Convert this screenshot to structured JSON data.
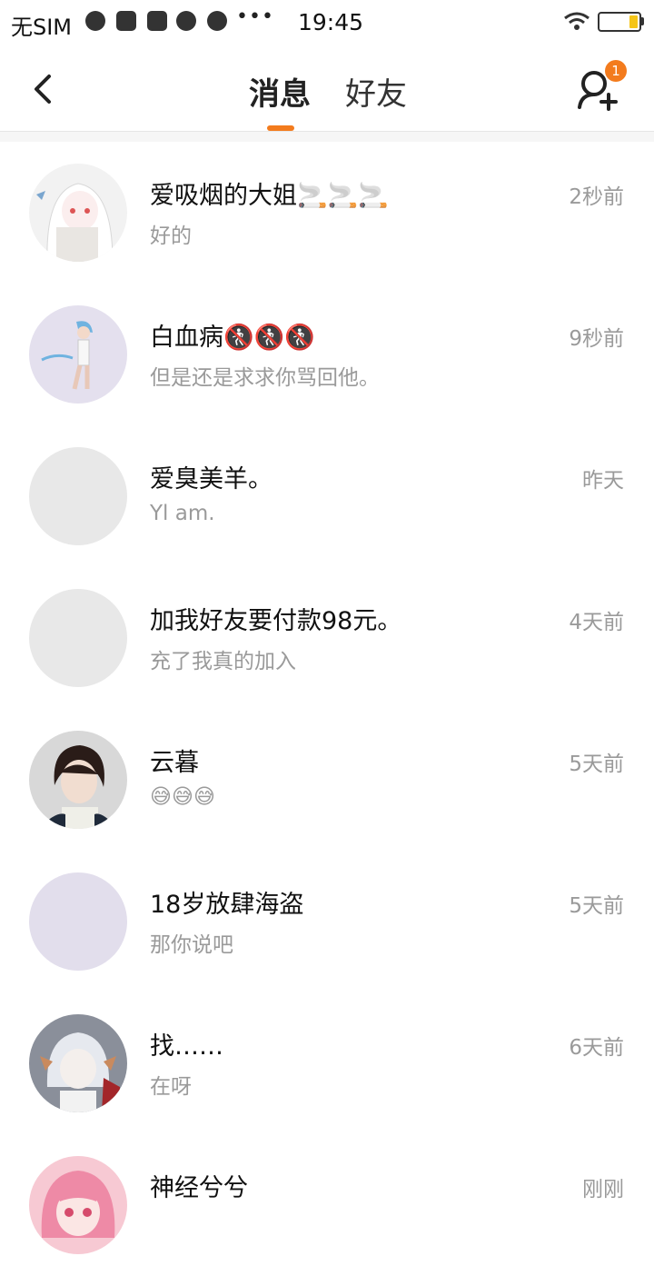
{
  "status_bar": {
    "carrier": "无SIM",
    "more": "•••",
    "time": "19:45"
  },
  "nav": {
    "tab_messages": "消息",
    "tab_friends": "好友",
    "friend_request_badge": "1"
  },
  "conversations": [
    {
      "name": "爱吸烟的大姐🚬🚬🚬",
      "preview": "好的",
      "time": "2秒前",
      "avatar": "anime-white-hair-avatar"
    },
    {
      "name": "白血病🚷🚷🚷",
      "preview": "但是还是求求你骂回他。",
      "time": "9秒前",
      "avatar": "anime-figure-avatar"
    },
    {
      "name": "爱臭美羊。",
      "preview": "Yl am.",
      "time": "昨天",
      "avatar": "blank-avatar"
    },
    {
      "name": "加我好友要付款98元。",
      "preview": "充了我真的加入",
      "time": "4天前",
      "avatar": "blank-avatar"
    },
    {
      "name": "云暮",
      "preview": "😅😅😅",
      "time": "5天前",
      "avatar": "dark-hair-boy-avatar"
    },
    {
      "name": "18岁放肆海盗",
      "preview": " 那你说吧",
      "time": "5天前",
      "avatar": "lavender-avatar"
    },
    {
      "name": "找……",
      "preview": "在呀",
      "time": "6天前",
      "avatar": "silver-hair-horns-avatar"
    },
    {
      "name": "神经兮兮",
      "preview": "",
      "time": "刚刚",
      "avatar": "pink-hair-avatar"
    }
  ]
}
